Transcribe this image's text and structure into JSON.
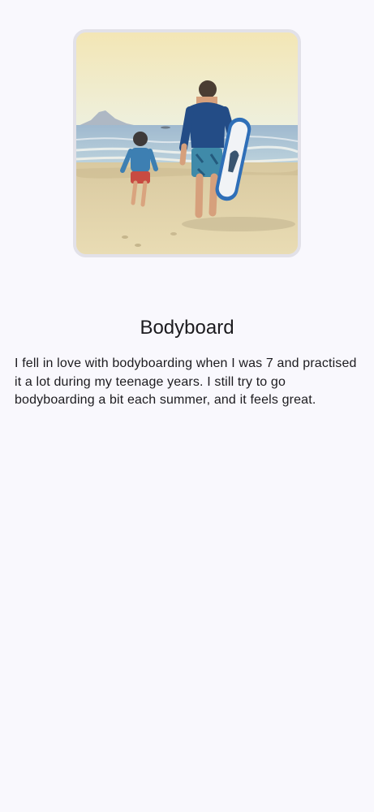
{
  "detail": {
    "title": "Bodyboard",
    "description": "I fell in love with bodyboarding when I was 7 and practised it a lot during my teenage years. I still try to go bodyboarding a bit each summer, and it feels great."
  },
  "colors": {
    "background": "#f9f8fd",
    "text": "#1c1b1f",
    "image_border": "#e2e1e8"
  }
}
